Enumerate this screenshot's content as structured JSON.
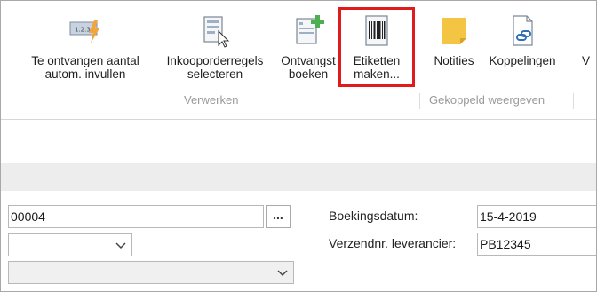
{
  "ribbon": {
    "buttons": [
      {
        "line1": "Te ontvangen aantal",
        "line2": "autom. invullen",
        "icon": "auto-fill-icon"
      },
      {
        "line1": "Inkooporderregels",
        "line2": "selecteren",
        "icon": "select-lines-icon"
      },
      {
        "line1": "Ontvangst",
        "line2": "boeken",
        "icon": "post-receipt-icon"
      },
      {
        "line1": "Etiketten",
        "line2": "maken...",
        "icon": "barcode-icon"
      },
      {
        "line1": "Notities",
        "line2": "",
        "icon": "notes-icon"
      },
      {
        "line1": "Koppelingen",
        "line2": "",
        "icon": "links-icon"
      },
      {
        "line1": "V",
        "line2": "",
        "icon": ""
      }
    ],
    "groups": {
      "process": "Verwerken",
      "linked": "Gekoppeld weergeven"
    },
    "icon_badge_text": "1.2.3."
  },
  "form": {
    "number_value": "00004",
    "lookup_button": "...",
    "posting_date_label": "Boekingsdatum:",
    "posting_date_value": "15-4-2019",
    "vendor_shipment_label": "Verzendnr. leverancier:",
    "vendor_shipment_value": "PB12345"
  },
  "colors": {
    "highlight": "#e01b1b",
    "band": "#ededed",
    "notes_yellow": "#f4c542",
    "link_blue": "#2f6fb3"
  }
}
